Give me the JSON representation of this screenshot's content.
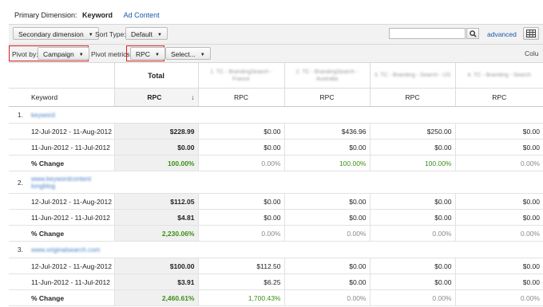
{
  "primary": {
    "label": "Primary Dimension:",
    "active": "Keyword",
    "link": "Ad Content"
  },
  "toolbar": {
    "secondary_dimension": "Secondary dimension",
    "sort_type_label": "Sort Type:",
    "sort_type_value": "Default",
    "search_placeholder": "",
    "advanced": "advanced"
  },
  "pivot": {
    "pivot_by_label": "Pivot by:",
    "pivot_by_value": "Campaign",
    "pivot_metrics_label": "Pivot metrics:",
    "metric_value": "RPC",
    "select_label": "Select...",
    "columns_cut": "Colu"
  },
  "table": {
    "total_header": "Total",
    "keyword_header": "Keyword",
    "metric_header": "RPC",
    "pivot_columns": [
      "1. TC - BrandingSearch - France",
      "2. TC - BrandingSearch - Australia",
      "3. TC - Branding - Search - US",
      "4. TC - Branding - Search"
    ],
    "rows": [
      {
        "index": "1.",
        "keyword": "keyword",
        "periods": [
          {
            "label": "12-Jul-2012 - 11-Aug-2012",
            "total": "$228.99",
            "cols": [
              "$0.00",
              "$436.96",
              "$250.00",
              "$0.00"
            ]
          },
          {
            "label": "11-Jun-2012 - 11-Jul-2012",
            "total": "$0.00",
            "cols": [
              "$0.00",
              "$0.00",
              "$0.00",
              "$0.00"
            ]
          }
        ],
        "change": {
          "label": "% Change",
          "total": "100.00%",
          "cols": [
            "0.00%",
            "100.00%",
            "100.00%",
            "0.00%"
          ]
        }
      },
      {
        "index": "2.",
        "keyword": "www.keywordcontent longblog",
        "periods": [
          {
            "label": "12-Jul-2012 - 11-Aug-2012",
            "total": "$112.05",
            "cols": [
              "$0.00",
              "$0.00",
              "$0.00",
              "$0.00"
            ]
          },
          {
            "label": "11-Jun-2012 - 11-Jul-2012",
            "total": "$4.81",
            "cols": [
              "$0.00",
              "$0.00",
              "$0.00",
              "$0.00"
            ]
          }
        ],
        "change": {
          "label": "% Change",
          "total": "2,230.06%",
          "cols": [
            "0.00%",
            "0.00%",
            "0.00%",
            "0.00%"
          ]
        }
      },
      {
        "index": "3.",
        "keyword": "www.originalsearch.com",
        "periods": [
          {
            "label": "12-Jul-2012 - 11-Aug-2012",
            "total": "$100.00",
            "cols": [
              "$112.50",
              "$0.00",
              "$0.00",
              "$0.00"
            ]
          },
          {
            "label": "11-Jun-2012 - 11-Jul-2012",
            "total": "$3.91",
            "cols": [
              "$6.25",
              "$0.00",
              "$0.00",
              "$0.00"
            ]
          }
        ],
        "change": {
          "label": "% Change",
          "total": "2,460.61%",
          "cols": [
            "1,700.43%",
            "0.00%",
            "0.00%",
            "0.00%"
          ]
        }
      }
    ]
  },
  "colors": {
    "link": "#1a5aa8",
    "highlight": "#d9201f",
    "positive": "#3b8f17"
  }
}
